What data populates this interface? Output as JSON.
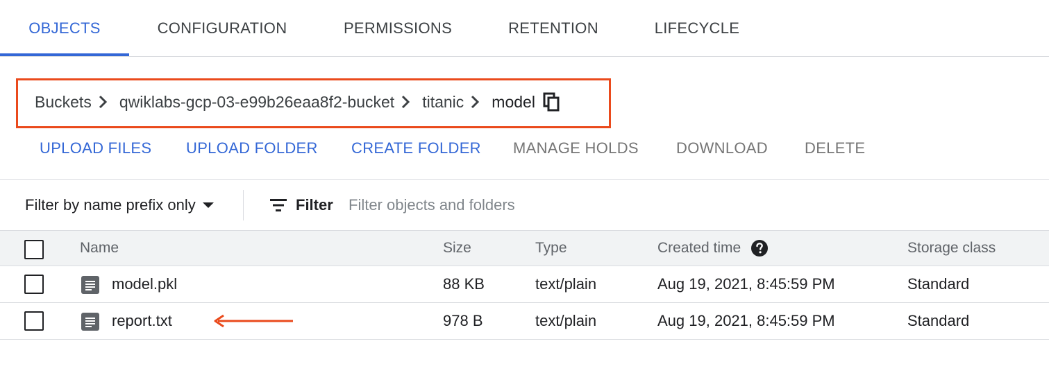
{
  "tabs": [
    {
      "label": "OBJECTS",
      "active": true
    },
    {
      "label": "CONFIGURATION",
      "active": false
    },
    {
      "label": "PERMISSIONS",
      "active": false
    },
    {
      "label": "RETENTION",
      "active": false
    },
    {
      "label": "LIFECYCLE",
      "active": false
    }
  ],
  "breadcrumb": {
    "items": [
      "Buckets",
      "qwiklabs-gcp-03-e99b26eaa8f2-bucket",
      "titanic",
      "model"
    ],
    "copy_icon": "copy-icon",
    "highlight_color": "#ea4a1c"
  },
  "actions": {
    "upload_files": "UPLOAD FILES",
    "upload_folder": "UPLOAD FOLDER",
    "create_folder": "CREATE FOLDER",
    "manage_holds": "MANAGE HOLDS",
    "download": "DOWNLOAD",
    "delete": "DELETE"
  },
  "filter": {
    "prefix_select": "Filter by name prefix only",
    "filter_label": "Filter",
    "placeholder": "Filter objects and folders",
    "value": ""
  },
  "table": {
    "headers": {
      "name": "Name",
      "size": "Size",
      "type": "Type",
      "created": "Created time",
      "storage": "Storage class"
    },
    "rows": [
      {
        "name": "model.pkl",
        "size": "88 KB",
        "type": "text/plain",
        "created": "Aug 19, 2021, 8:45:59 PM",
        "storage": "Standard"
      },
      {
        "name": "report.txt",
        "size": "978 B",
        "type": "text/plain",
        "created": "Aug 19, 2021, 8:45:59 PM",
        "storage": "Standard"
      }
    ]
  },
  "colors": {
    "accent": "#3367d6",
    "annotation": "#ea4a1c"
  }
}
